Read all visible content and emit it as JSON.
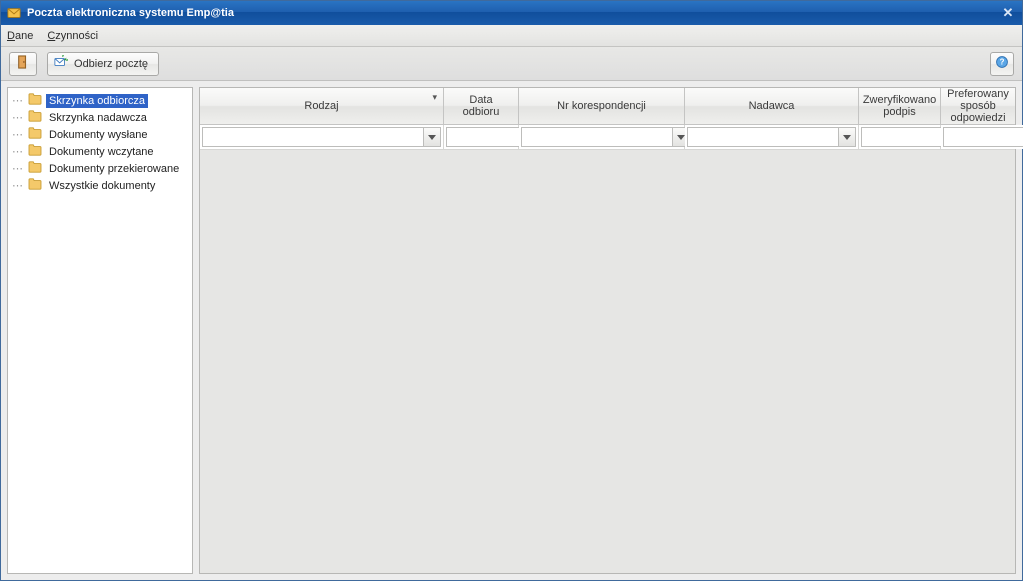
{
  "window": {
    "title": "Poczta elektroniczna systemu Emp@tia"
  },
  "menu": {
    "dane": "Dane",
    "czynnosci": "Czynności"
  },
  "toolbar": {
    "fetch_label": "Odbierz pocztę"
  },
  "sidebar": {
    "items": [
      {
        "label": "Skrzynka odbiorcza",
        "selected": true
      },
      {
        "label": "Skrzynka nadawcza",
        "selected": false
      },
      {
        "label": "Dokumenty wysłane",
        "selected": false
      },
      {
        "label": "Dokumenty wczytane",
        "selected": false
      },
      {
        "label": "Dokumenty przekierowane",
        "selected": false
      },
      {
        "label": "Wszystkie dokumenty",
        "selected": false
      }
    ]
  },
  "grid": {
    "columns": {
      "rodzaj": "Rodzaj",
      "data": "Data odbioru",
      "nr": "Nr korespondencji",
      "nadawca": "Nadawca",
      "podpis": "Zweryfikowano podpis",
      "pref": "Preferowany sposób odpowiedzi"
    },
    "filters": {
      "rodzaj": "",
      "data": "",
      "nr": "",
      "nadawca": "",
      "podpis": "",
      "pref": ""
    },
    "rows": []
  }
}
